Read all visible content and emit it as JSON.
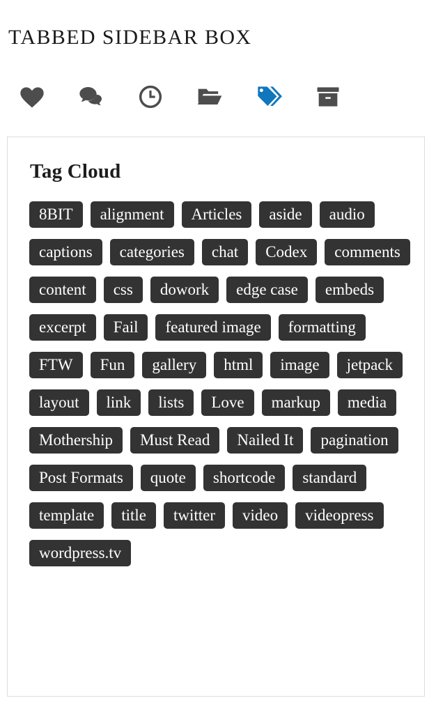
{
  "page": {
    "title": "TABBED SIDEBAR BOX"
  },
  "colors": {
    "tab_icon_inactive": "#4d4d4d",
    "tab_icon_active": "#1077bc",
    "tag_background": "#333333",
    "tag_text": "#ffffff",
    "panel_border": "#dcdcdc",
    "page_background": "#ffffff"
  },
  "tabs": [
    {
      "name": "heart-icon",
      "label": "Favorites",
      "active": false
    },
    {
      "name": "comments-icon",
      "label": "Comments",
      "active": false
    },
    {
      "name": "clock-icon",
      "label": "Recent",
      "active": false
    },
    {
      "name": "folder-open-icon",
      "label": "Categories",
      "active": false
    },
    {
      "name": "tags-icon",
      "label": "Tags",
      "active": true
    },
    {
      "name": "archive-box-icon",
      "label": "Archives",
      "active": false
    }
  ],
  "widget": {
    "title": "Tag Cloud",
    "tags": [
      "8BIT",
      "alignment",
      "Articles",
      "aside",
      "audio",
      "captions",
      "categories",
      "chat",
      "Codex",
      "comments",
      "content",
      "css",
      "dowork",
      "edge case",
      "embeds",
      "excerpt",
      "Fail",
      "featured image",
      "formatting",
      "FTW",
      "Fun",
      "gallery",
      "html",
      "image",
      "jetpack",
      "layout",
      "link",
      "lists",
      "Love",
      "markup",
      "media",
      "Mothership",
      "Must Read",
      "Nailed It",
      "pagination",
      "Post Formats",
      "quote",
      "shortcode",
      "standard",
      "template",
      "title",
      "twitter",
      "video",
      "videopress",
      "wordpress.tv"
    ]
  }
}
